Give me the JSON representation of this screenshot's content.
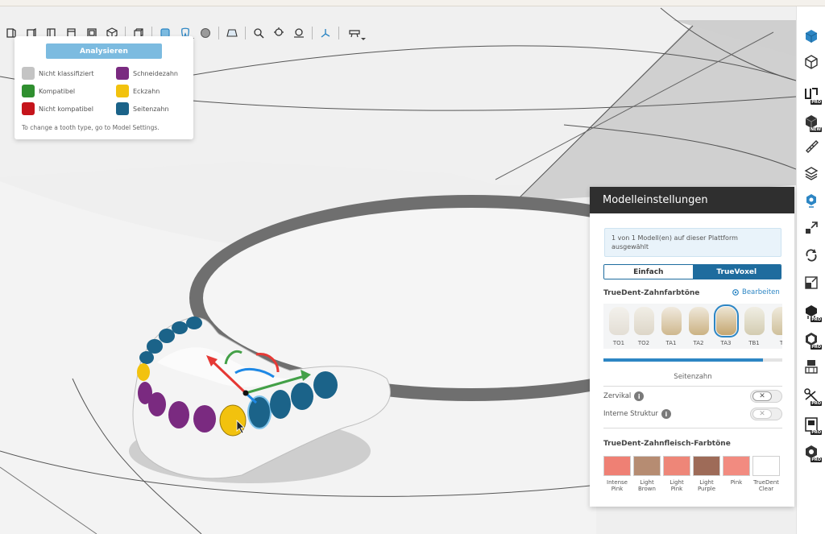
{
  "legend": {
    "analyze_button": "Analysieren",
    "items": [
      {
        "label": "Nicht klassifiziert",
        "color": "#c4c4c4"
      },
      {
        "label": "Schneidezahn",
        "color": "#7a2a80"
      },
      {
        "label": "Kompatibel",
        "color": "#2f8f2f"
      },
      {
        "label": "Eckzahn",
        "color": "#f2c20e"
      },
      {
        "label": "Nicht kompatibel",
        "color": "#c5141b"
      },
      {
        "label": "Seitenzahn",
        "color": "#1b6389"
      }
    ],
    "note": "To change a tooth type, go to Model Settings."
  },
  "toolbar": {
    "icons": [
      "front-view-icon",
      "left-view-icon",
      "back-view-icon",
      "right-view-icon",
      "bottom-view-icon",
      "iso-view-icon",
      "perspective-icon",
      "view-mode-icon",
      "tooth-mode-icon",
      "sphere-icon",
      "platform-icon",
      "zoom-icon",
      "zoom-all-icon",
      "zoom-selection-icon",
      "axis-icon",
      "camera-icon"
    ]
  },
  "right_toolbar": {
    "icons": [
      {
        "name": "add-model-icon",
        "badge": ""
      },
      {
        "name": "model-outline-icon",
        "badge": ""
      },
      {
        "name": "layout-pro-icon",
        "badge": "PRO"
      },
      {
        "name": "orient-new-icon",
        "badge": "NEW"
      },
      {
        "name": "measure-icon",
        "badge": ""
      },
      {
        "name": "layers-icon",
        "badge": ""
      },
      {
        "name": "model-settings-icon",
        "badge": ""
      },
      {
        "name": "move-icon",
        "badge": ""
      },
      {
        "name": "rotate-icon",
        "badge": ""
      },
      {
        "name": "scale-icon",
        "badge": ""
      },
      {
        "name": "support-pro-icon",
        "badge": "PRO"
      },
      {
        "name": "hollow-pro-icon",
        "badge": "PRO"
      },
      {
        "name": "lattice-icon",
        "badge": ""
      },
      {
        "name": "cut-pro-icon",
        "badge": "PRO"
      },
      {
        "name": "label-pro-icon",
        "badge": "PRO"
      },
      {
        "name": "repair-pro-icon",
        "badge": "PRO"
      }
    ]
  },
  "panel": {
    "title": "Modelleinstellungen",
    "info": "1 von 1 Modell(en) auf dieser Plattform ausgewählt",
    "tab_simple": "Einfach",
    "tab_truevoxel": "TrueVoxel",
    "shades_title": "TrueDent-Zahnfarbtöne",
    "edit_link": "Bearbeiten",
    "shades": [
      {
        "label": "TO1",
        "color": "#ebe7e0",
        "selected": false
      },
      {
        "label": "TO2",
        "color": "#e8e2d6",
        "selected": false
      },
      {
        "label": "TA1",
        "color": "#e2d3b4",
        "selected": false
      },
      {
        "label": "TA2",
        "color": "#e0cfa9",
        "selected": false
      },
      {
        "label": "TA3",
        "color": "#dcc69a",
        "selected": true
      },
      {
        "label": "TB1",
        "color": "#e3dfcb",
        "selected": false
      },
      {
        "label": "T",
        "color": "#e5ddc5",
        "selected": false
      }
    ],
    "shade_scroll_fraction": 0.89,
    "tooth_type": "Seitenzahn",
    "options": [
      {
        "label": "Zervikal",
        "value": "✕"
      },
      {
        "label": "Interne Struktur",
        "value": "✕"
      }
    ],
    "gum_title": "TrueDent-Zahnfleisch-Farbtöne",
    "gums": [
      {
        "label": "Intense Pink",
        "color": "#ef8074"
      },
      {
        "label": "Light Brown",
        "color": "#b68c72"
      },
      {
        "label": "Light Pink",
        "color": "#ee8678"
      },
      {
        "label": "Light Purple",
        "color": "#9e6b58"
      },
      {
        "label": "Pink",
        "color": "#f28b80"
      },
      {
        "label": "TrueDent Clear",
        "color": "#ffffff"
      }
    ]
  }
}
